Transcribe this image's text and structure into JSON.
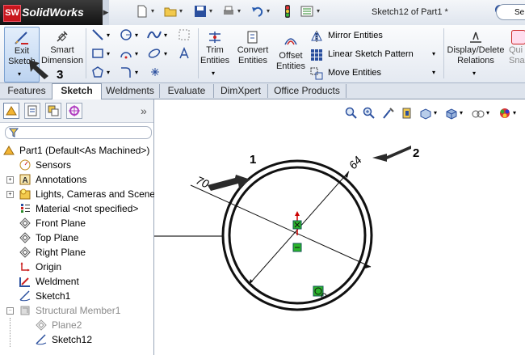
{
  "titlebar": {
    "logo_box": "SW",
    "logo_text": "SolidWorks",
    "doc_title": "Sketch12 of Part1 *",
    "search_text": "Se"
  },
  "ribbon": {
    "exit_sketch": [
      "Exit",
      "Sketch"
    ],
    "smart_dimension": [
      "Smart",
      "Dimension"
    ],
    "trim_entities": [
      "Trim",
      "Entities"
    ],
    "convert_entities": [
      "Convert",
      "Entities"
    ],
    "offset_entities": [
      "Offset",
      "Entities"
    ],
    "mirror_entities": "Mirror Entities",
    "linear_sketch_pattern": "Linear Sketch Pattern",
    "move_entities": "Move Entities",
    "display_delete_relations": [
      "Display/Delete",
      "Relations"
    ],
    "quick_snaps": [
      "Qui",
      "Sna"
    ]
  },
  "tabs": [
    "Features",
    "Sketch",
    "Weldments",
    "Evaluate",
    "DimXpert",
    "Office Products"
  ],
  "active_tab": "Sketch",
  "tree": [
    {
      "label": "Part1  (Default<As Machined>)",
      "icon": "part-icon"
    },
    {
      "label": "Sensors",
      "icon": "sensors-icon"
    },
    {
      "label": "Annotations",
      "icon": "annotations-icon"
    },
    {
      "label": "Lights, Cameras and Scene",
      "icon": "lights-icon"
    },
    {
      "label": "Material <not specified>",
      "icon": "material-icon"
    },
    {
      "label": "Front Plane",
      "icon": "plane-icon"
    },
    {
      "label": "Top Plane",
      "icon": "plane-icon"
    },
    {
      "label": "Right Plane",
      "icon": "plane-icon"
    },
    {
      "label": "Origin",
      "icon": "origin-icon"
    },
    {
      "label": "Weldment",
      "icon": "weldment-icon"
    },
    {
      "label": "Sketch1",
      "icon": "sketch-icon"
    },
    {
      "label": "Structural Member1",
      "icon": "structural-member-icon"
    },
    {
      "label": "Plane2",
      "icon": "plane-icon"
    },
    {
      "label": "Sketch12",
      "icon": "sketch-icon"
    }
  ],
  "sketch": {
    "dim_outer": "70",
    "dim_inner": "64"
  },
  "callouts": [
    "1",
    "2",
    "3"
  ],
  "colors": {
    "logo_red": "#c8161d",
    "ribbon_highlight": "#bcd3f0",
    "origin_red": "#cc0000",
    "relation_green": "#22aa22"
  }
}
